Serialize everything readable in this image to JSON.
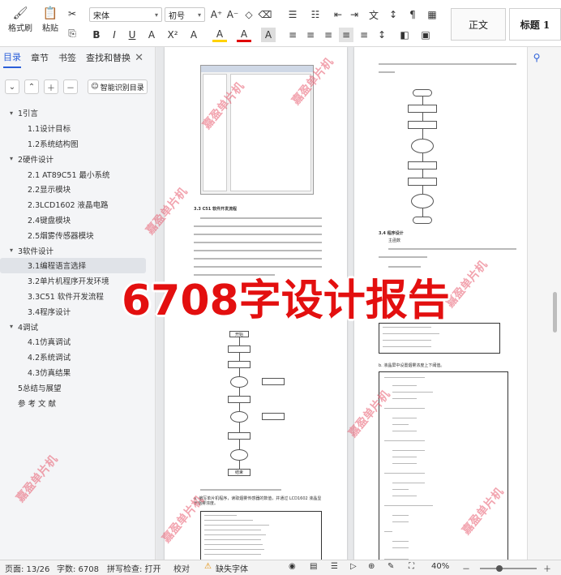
{
  "ribbon": {
    "format_painter": "格式刷",
    "paste": "粘贴",
    "font_name": "宋体",
    "font_size": "初号",
    "style_normal": "正文",
    "style_heading1": "标题 1",
    "tools_row1": [
      "A⁺",
      "A⁻",
      "◇",
      "⌫"
    ],
    "tools_row2": [
      "B",
      "I",
      "U",
      "A",
      "X²",
      "A",
      "A",
      "A"
    ],
    "para_row2": [
      "≡",
      "≡",
      "≡",
      "≡",
      "≡",
      "↕"
    ]
  },
  "nav": {
    "tabs": [
      "目录",
      "章节",
      "书签",
      "查找和替换"
    ],
    "close": "✕",
    "smart_label": "智能识别目录",
    "toc": [
      {
        "label": "1引言",
        "level": 0,
        "caret": "▾"
      },
      {
        "label": "1.1设计目标",
        "level": 1
      },
      {
        "label": "1.2系统结构图",
        "level": 1
      },
      {
        "label": "2硬件设计",
        "level": 0,
        "caret": "▾"
      },
      {
        "label": "2.1  AT89C51 最小系统",
        "level": 1
      },
      {
        "label": "2.2显示模块",
        "level": 1
      },
      {
        "label": "2.3LCD1602 液晶电路",
        "level": 1
      },
      {
        "label": "2.4键盘模块",
        "level": 1
      },
      {
        "label": "2.5烟雾传感器模块",
        "level": 1
      },
      {
        "label": "3软件设计",
        "level": 0,
        "caret": "▾"
      },
      {
        "label": "3.1编程语言选择",
        "level": 1,
        "selected": true
      },
      {
        "label": "3.2单片机程序开发环境",
        "level": 1
      },
      {
        "label": "3.3C51 软件开发流程",
        "level": 1
      },
      {
        "label": "3.4程序设计",
        "level": 1
      },
      {
        "label": "4调试",
        "level": 0,
        "caret": "▾"
      },
      {
        "label": "4.1仿真调试",
        "level": 1
      },
      {
        "label": "4.2系统调试",
        "level": 1
      },
      {
        "label": "4.3仿真结果",
        "level": 1
      },
      {
        "label": "5总结与展望",
        "level": 0
      },
      {
        "label": "参 考 文 献",
        "level": 0
      }
    ]
  },
  "document": {
    "left_heading": "3.3 C51 软件开发流程",
    "right_heading": "3.4 程序设计",
    "right_sub": "主函数",
    "right_item": "b. 液晶屏中设置烟雾浓度上下阈值。",
    "left_item": "a. 编写单片机程序，读取烟雾传感器的数值，并通过 LCD1602 液晶显示烟雾浓度。",
    "flow_start": "开始",
    "flow_end": "结束"
  },
  "overlay": "6708字设计报告",
  "watermark": "嘉盈单片机",
  "status": {
    "page": "页面: 13/26",
    "words": "字数: 6708",
    "spell": "拼写检查: 打开",
    "proof": "校对",
    "missing_font": "缺失字体",
    "zoom": "40%"
  }
}
